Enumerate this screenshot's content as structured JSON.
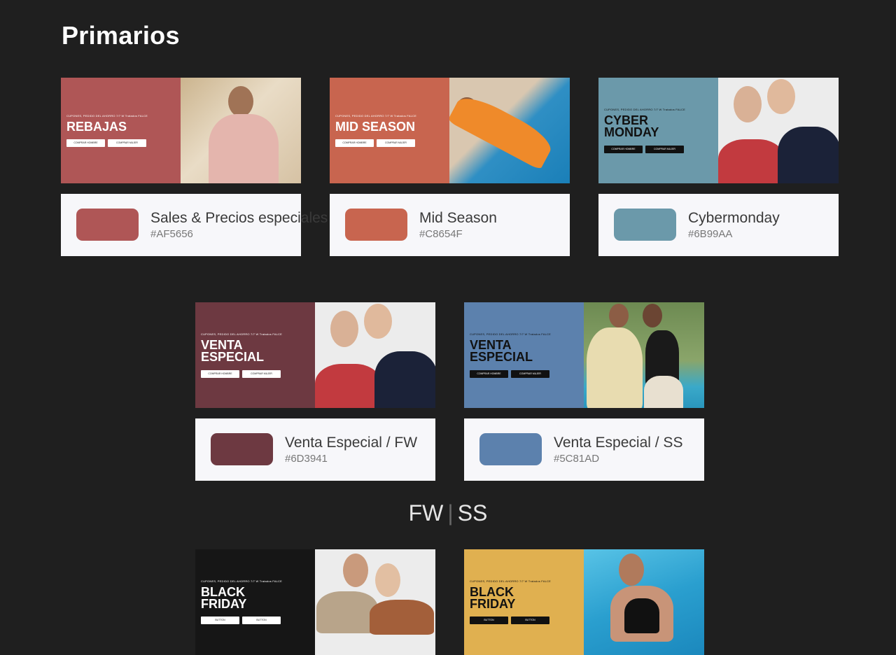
{
  "page": {
    "title": "Primarios"
  },
  "banner_small_text": "CUPONES, PEDIDO DEL AHORRO 7/7 W Tratados FALCE",
  "cards": [
    {
      "headline": "REBAJAS",
      "btn1": "COMPRAR HOMBRE",
      "btn2": "COMPRAR MUJER",
      "name": "Sales & Precios especiales",
      "hex": "#AF5656",
      "color": "#AF5656",
      "text_color": "#ffffff",
      "btn_style": "light"
    },
    {
      "headline": "MID SEASON",
      "btn1": "COMPRAR HOMBRE",
      "btn2": "COMPRAR MUJER",
      "name": "Mid Season",
      "hex": "#C8654F",
      "color": "#C8654F",
      "text_color": "#ffffff",
      "btn_style": "light"
    },
    {
      "headline": "CYBER MONDAY",
      "btn1": "COMPRAR HOMBRE",
      "btn2": "COMPRAR MUJER",
      "name": "Cybermonday",
      "hex": "#6B99AA",
      "color": "#6B99AA",
      "text_color": "#111111",
      "btn_style": "dark"
    },
    {
      "headline": "VENTA ESPECIAL",
      "btn1": "COMPRAR HOMBRE",
      "btn2": "COMPRAR MUJER",
      "name": "Venta Especial / FW",
      "hex": "#6D3941",
      "color": "#6D3941",
      "text_color": "#ffffff",
      "btn_style": "light"
    },
    {
      "headline": "VENTA ESPECIAL",
      "btn1": "COMPRAR HOMBRE",
      "btn2": "COMPRAR MUJER",
      "name": "Venta Especial / SS",
      "hex": "#5C81AD",
      "color": "#5C81AD",
      "text_color": "#111111",
      "btn_style": "dark"
    },
    {
      "headline": "BLACK FRIDAY",
      "btn1": "BUTTON",
      "btn2": "BUTTON",
      "color": "#161616",
      "text_color": "#ffffff",
      "btn_style": "light"
    },
    {
      "headline": "BLACK FRIDAY",
      "btn1": "BUTTON",
      "btn2": "BUTTON",
      "color": "#E0B050",
      "text_color": "#111111",
      "btn_style": "dark"
    }
  ],
  "season": {
    "fw": "FW",
    "ss": "SS"
  }
}
